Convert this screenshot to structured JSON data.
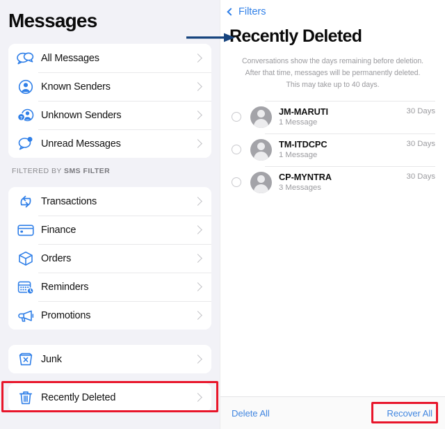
{
  "left": {
    "title": "Messages",
    "group1": [
      {
        "label": "All Messages",
        "icon": "two-speech-bubbles-icon"
      },
      {
        "label": "Known Senders",
        "icon": "person-circle-icon"
      },
      {
        "label": "Unknown Senders",
        "icon": "person-question-icon"
      },
      {
        "label": "Unread Messages",
        "icon": "speech-bubble-dot-icon"
      }
    ],
    "section_header_prefix": "FILTERED BY ",
    "section_header_bold": "SMS FILTER",
    "group2": [
      {
        "label": "Transactions",
        "icon": "transfer-arrows-icon"
      },
      {
        "label": "Finance",
        "icon": "credit-card-icon"
      },
      {
        "label": "Orders",
        "icon": "package-box-icon"
      },
      {
        "label": "Reminders",
        "icon": "calendar-clock-icon"
      },
      {
        "label": "Promotions",
        "icon": "megaphone-icon"
      }
    ],
    "group3": [
      {
        "label": "Junk",
        "icon": "junk-bin-icon"
      }
    ],
    "group4": [
      {
        "label": "Recently Deleted",
        "icon": "trash-icon"
      }
    ]
  },
  "right": {
    "back_label": "Filters",
    "title": "Recently Deleted",
    "description_lines": [
      "Conversations show the days remaining before deletion.",
      "After that time, messages will be permanently deleted.",
      "This may take up to 40 days."
    ],
    "conversations": [
      {
        "name": "JM-MARUTI",
        "messages": "1 Message",
        "days": "30 Days"
      },
      {
        "name": "TM-ITDCPC",
        "messages": "1 Message",
        "days": "30 Days"
      },
      {
        "name": "CP-MYNTRA",
        "messages": "3 Messages",
        "days": "30 Days"
      }
    ],
    "toolbar": {
      "delete_all": "Delete All",
      "recover_all": "Recover All"
    }
  },
  "annotations": {
    "arrow_color": "#17447e",
    "highlight_color": "#e8152a"
  },
  "colors": {
    "accent_blue": "#2f7fe8",
    "panel_bg": "#f2f2f7",
    "card_bg": "#ffffff",
    "muted_text": "#9a9a9e"
  }
}
